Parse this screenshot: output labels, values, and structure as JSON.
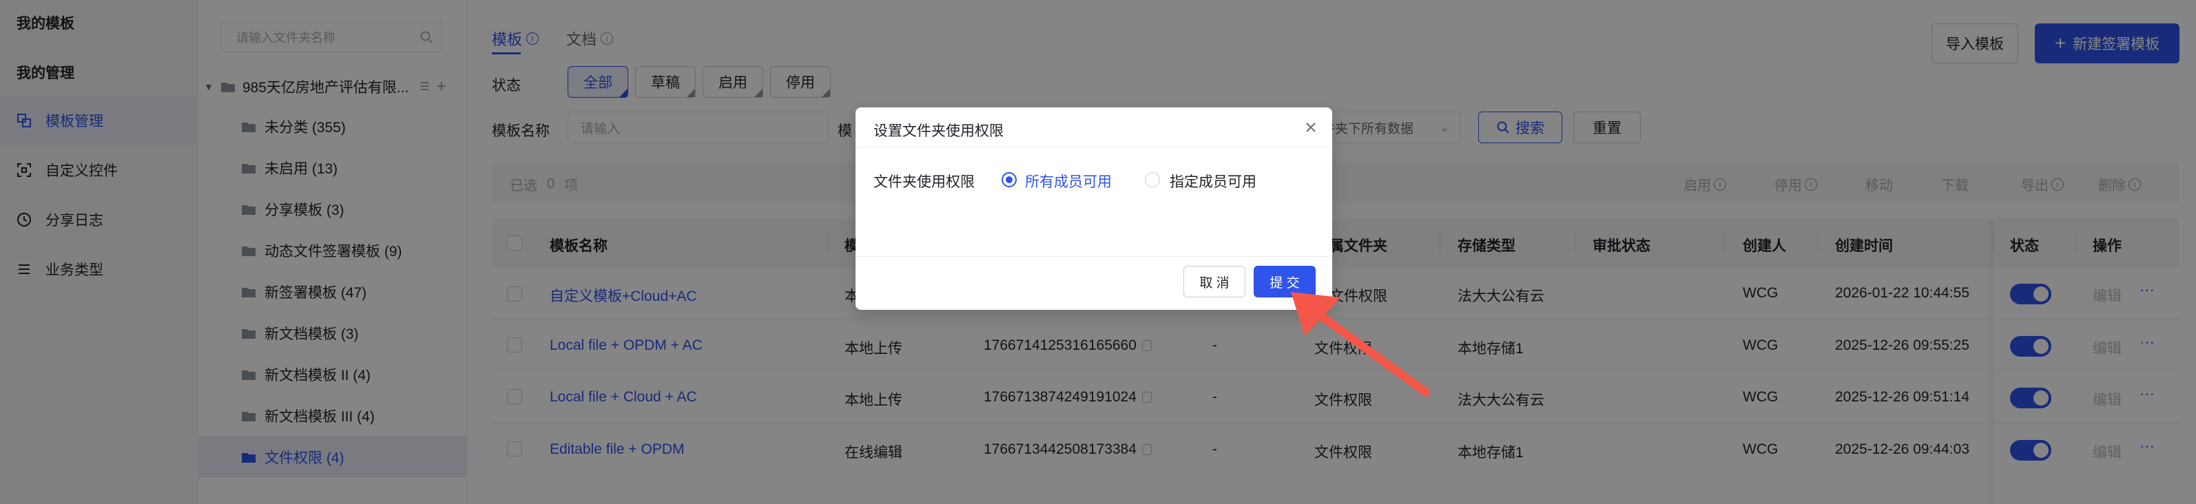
{
  "sidebar": {
    "groups": [
      "我的模板",
      "我的管理"
    ],
    "items": [
      {
        "label": "模板管理",
        "icon": "template-icon",
        "active": true
      },
      {
        "label": "自定义控件",
        "icon": "scan-icon",
        "active": false
      },
      {
        "label": "分享日志",
        "icon": "clock-icon",
        "active": false
      },
      {
        "label": "业务类型",
        "icon": "list-icon",
        "active": false
      }
    ]
  },
  "folders": {
    "search_placeholder": "请输入文件夹名称",
    "root": "985天亿房地产评估有限...",
    "items": [
      {
        "label": "未分类 (355)",
        "active": false
      },
      {
        "label": "未启用 (13)",
        "active": false
      },
      {
        "label": "分享模板 (3)",
        "active": false
      },
      {
        "label": "动态文件签署模板 (9)",
        "active": false
      },
      {
        "label": "新签署模板 (47)",
        "active": false
      },
      {
        "label": "新文档模板 (3)",
        "active": false
      },
      {
        "label": "新文档模板 II (4)",
        "active": false
      },
      {
        "label": "新文档模板 III (4)",
        "active": false
      },
      {
        "label": "文件权限 (4)",
        "active": true
      }
    ]
  },
  "header": {
    "tabs": [
      {
        "label": "模板",
        "active": true
      },
      {
        "label": "文档",
        "active": false
      }
    ],
    "import_button": "导入模板",
    "new_button": "新建签署模板"
  },
  "filters": {
    "status_label": "状态",
    "status_options": [
      "全部",
      "草稿",
      "启用",
      "停用"
    ],
    "name_label": "模板名称",
    "name_placeholder": "请输入",
    "partial_label": "模",
    "scope_value": "件夹下所有数据",
    "search_button": "搜索",
    "reset_button": "重置"
  },
  "bulk": {
    "selected_text": "已选",
    "selected_count": "0",
    "selected_unit": "项",
    "actions": [
      "启用",
      "停用",
      "移动",
      "下载",
      "导出",
      "删除"
    ]
  },
  "table": {
    "columns": [
      "模板名称",
      "模",
      "属文件夹",
      "存储类型",
      "审批状态",
      "创建人",
      "创建时间",
      "状态",
      "操作"
    ],
    "rows": [
      {
        "name": "自定义模板+Cloud+AC",
        "source": "本",
        "id": "",
        "dash": "",
        "folder": "文件权限",
        "storage": "法大大公有云",
        "approval": "",
        "creator": "WCG",
        "created": "2026-01-22 10:44:55",
        "edit": "编辑",
        "more": "···"
      },
      {
        "name": "Local file + OPDM + AC",
        "source": "本地上传",
        "id": "1766714125316165660",
        "dash": "-",
        "folder": "文件权限",
        "storage": "本地存储1",
        "approval": "",
        "creator": "WCG",
        "created": "2025-12-26 09:55:25",
        "edit": "编辑",
        "more": "···"
      },
      {
        "name": "Local file + Cloud + AC",
        "source": "本地上传",
        "id": "1766713874249191024",
        "dash": "-",
        "folder": "文件权限",
        "storage": "法大大公有云",
        "approval": "",
        "creator": "WCG",
        "created": "2025-12-26 09:51:14",
        "edit": "编辑",
        "more": "···"
      },
      {
        "name": "Editable file + OPDM",
        "source": "在线编辑",
        "id": "1766713442508173384",
        "dash": "-",
        "folder": "文件权限",
        "storage": "本地存储1",
        "approval": "",
        "creator": "WCG",
        "created": "2025-12-26 09:44:03",
        "edit": "编辑",
        "more": "···"
      }
    ]
  },
  "modal": {
    "title": "设置文件夹使用权限",
    "field_label": "文件夹使用权限",
    "options": [
      {
        "label": "所有成员可用",
        "checked": true
      },
      {
        "label": "指定成员可用",
        "checked": false
      }
    ],
    "cancel": "取 消",
    "submit": "提 交"
  },
  "colors": {
    "accent": "#2f54eb",
    "annotation_arrow": "#f5564a"
  }
}
